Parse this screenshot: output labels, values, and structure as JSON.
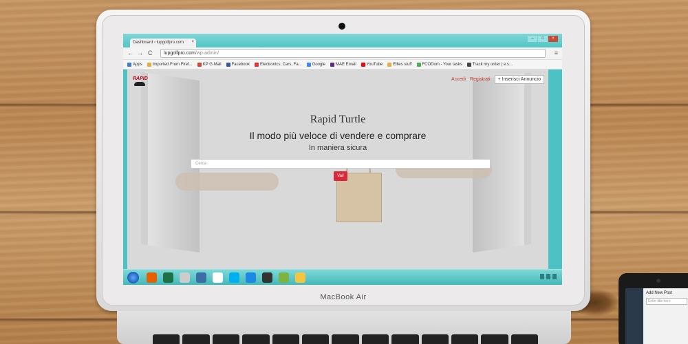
{
  "laptop": {
    "brand": "MacBook Air"
  },
  "browser": {
    "tab_title": "Dashboard ‹ lupgolfpro.com",
    "tab_close": "×",
    "url_host": "lupgolfpro.com",
    "url_path": "/wp-admin/",
    "back": "←",
    "forward": "→",
    "reload": "C",
    "bookmarks": [
      {
        "label": "Apps",
        "color": "#3a7bd5"
      },
      {
        "label": "Imported From Firef...",
        "color": "#e0b040"
      },
      {
        "label": "KP G Mail",
        "color": "#d44638"
      },
      {
        "label": "Facebook",
        "color": "#3b5998"
      },
      {
        "label": "Electronics, Cars, Fa...",
        "color": "#e53238"
      },
      {
        "label": "Google",
        "color": "#4285f4"
      },
      {
        "label": "MAE Email",
        "color": "#5b2c83"
      },
      {
        "label": "YouTube",
        "color": "#ff0000"
      },
      {
        "label": "Ellies stuff",
        "color": "#e0b040"
      },
      {
        "label": "FCODom - Your tasks",
        "color": "#4caf50"
      },
      {
        "label": "Track my order | e.s...",
        "color": "#444444"
      }
    ]
  },
  "page": {
    "logo": "RAPID",
    "login": "Accedi",
    "register": "Registrati",
    "insert_button": "+  Inserisci Annuncio",
    "title": "Rapid Turtle",
    "subtitle": "Il modo più veloce di vendere e comprare",
    "tagline": "In maniera sicura",
    "search_placeholder": "Cerca",
    "go_button": "Vai!"
  },
  "taskbar": {
    "icons": [
      {
        "name": "firefox-icon",
        "color": "#e66000"
      },
      {
        "name": "excel-icon",
        "color": "#1e7145"
      },
      {
        "name": "app-icon",
        "color": "#cccccc"
      },
      {
        "name": "media-icon",
        "color": "#3b6ea5"
      },
      {
        "name": "chrome-icon",
        "color": "#ffffff"
      },
      {
        "name": "skype-icon",
        "color": "#00aff0"
      },
      {
        "name": "app-icon-2",
        "color": "#1e88e5"
      },
      {
        "name": "app-icon-3",
        "color": "#333333"
      },
      {
        "name": "app-icon-4",
        "color": "#7cb342"
      },
      {
        "name": "folder-icon",
        "color": "#f4c542"
      }
    ]
  },
  "phone": {
    "title": "Add New Post",
    "input_placeholder": "Enter title here"
  }
}
